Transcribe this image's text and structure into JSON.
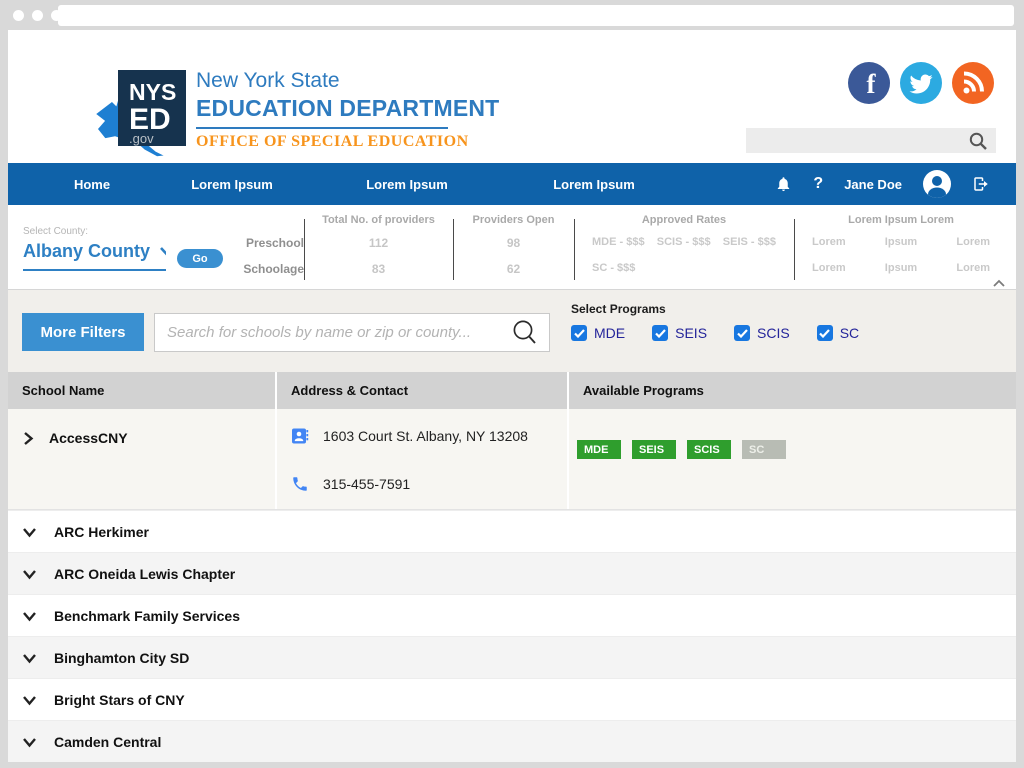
{
  "browser": {
    "address_bar_value": ""
  },
  "header": {
    "logo": {
      "acronym_line1": "NYS",
      "acronym_line2": "ED",
      "domain": ".gov"
    },
    "title_line1": "New York State",
    "title_line2": "EDUCATION DEPARTMENT",
    "subtitle": "OFFICE OF SPECIAL EDUCATION",
    "search": {
      "placeholder": ""
    },
    "social": [
      {
        "name": "facebook",
        "color": "#3b5998"
      },
      {
        "name": "twitter",
        "color": "#2caae1"
      },
      {
        "name": "rss",
        "color": "#f26522"
      }
    ]
  },
  "nav": {
    "items": [
      "Home",
      "Lorem Ipsum",
      "Lorem Ipsum",
      "Lorem Ipsum"
    ],
    "user_name": "Jane Doe"
  },
  "stats": {
    "select_county_label": "Select County:",
    "selected_county": "Albany County",
    "go_button_label": "Go",
    "row_labels": [
      "Preschool",
      "Schoolage"
    ],
    "columns": [
      {
        "header": "Total No. of providers",
        "rows": [
          [
            "112"
          ],
          [
            "83"
          ]
        ]
      },
      {
        "header": "Providers Open",
        "rows": [
          [
            "98"
          ],
          [
            "62"
          ]
        ]
      },
      {
        "header": "Approved Rates",
        "rows": [
          [
            "MDE - $$$",
            "SCIS - $$$",
            "SEIS - $$$"
          ],
          [
            "SC - $$$"
          ]
        ]
      },
      {
        "header": "Lorem Ipsum Lorem",
        "rows": [
          [
            "Lorem",
            "Ipsum",
            "Lorem"
          ],
          [
            "Lorem",
            "Ipsum",
            "Lorem"
          ]
        ]
      }
    ]
  },
  "filters": {
    "more_filters_label": "More Filters",
    "search_placeholder": "Search for schools by name or zip or county...",
    "select_programs_label": "Select Programs",
    "programs": [
      {
        "label": "MDE",
        "checked": true
      },
      {
        "label": "SEIS",
        "checked": true
      },
      {
        "label": "SCIS",
        "checked": true
      },
      {
        "label": "SC",
        "checked": true
      }
    ]
  },
  "table": {
    "headers": [
      "School Name",
      "Address & Contact",
      "Available Programs"
    ],
    "expanded_row": {
      "name": "AccessCNY",
      "address": "1603 Court St. Albany, NY 13208",
      "phone": "315-455-7591",
      "programs": [
        {
          "label": "MDE",
          "available": true
        },
        {
          "label": "SEIS",
          "available": true
        },
        {
          "label": "SCIS",
          "available": true
        },
        {
          "label": "SC",
          "available": false
        }
      ]
    },
    "collapsed_rows": [
      "ARC Herkimer",
      "ARC Oneida Lewis Chapter",
      "Benchmark Family Services",
      "Binghamton City SD",
      "Bright Stars of CNY",
      "Camden Central"
    ]
  },
  "colors": {
    "nav_blue": "#0f62a9",
    "link_blue": "#2e80c4",
    "button_blue": "#3a90d1",
    "checkbox_blue": "#1877e0",
    "title_blue": "#2e7bbf",
    "subtitle_orange": "#f7941d",
    "badge_green": "#2f9e2d",
    "badge_gray": "#b8bcb4"
  }
}
